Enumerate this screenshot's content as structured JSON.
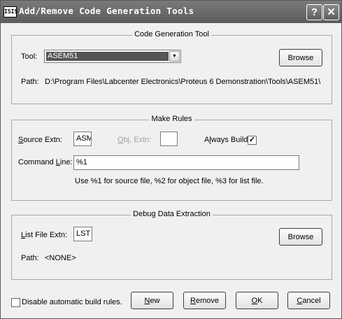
{
  "window": {
    "icon_text": "ISIS",
    "title": "Add/Remove Code Generation Tools",
    "help_label": "?",
    "close_label": "✕"
  },
  "code_tool": {
    "group_title": "Code Generation Tool",
    "tool_label": "Tool:",
    "tool_value": "ASEM51",
    "browse_label": "Browse",
    "path_label": "Path:",
    "path_value": "D:\\Program Files\\Labcenter Electronics\\Proteus 6 Demonstration\\Tools\\ASEM51\\"
  },
  "make_rules": {
    "group_title": "Make Rules",
    "source_extn_label": "Source Extn:",
    "source_extn_value": "ASM",
    "obj_extn_label": "Obj. Extn:",
    "obj_extn_value": "",
    "always_build_label": "Always Build:",
    "always_build_checked": true,
    "command_line_label": "Command Line:",
    "command_line_value": "%1",
    "hint": "Use %1 for source file, %2 for object file, %3 for list file."
  },
  "debug": {
    "group_title": "Debug Data Extraction",
    "list_file_extn_label": "List File Extn:",
    "list_file_extn_value": "LST",
    "browse_label": "Browse",
    "path_label": "Path:",
    "path_value": "<NONE>"
  },
  "footer": {
    "disable_auto_label": "Disable automatic build rules.",
    "disable_auto_checked": false,
    "new_label": "New",
    "remove_label": "Remove",
    "ok_label": "OK",
    "cancel_label": "Cancel"
  }
}
